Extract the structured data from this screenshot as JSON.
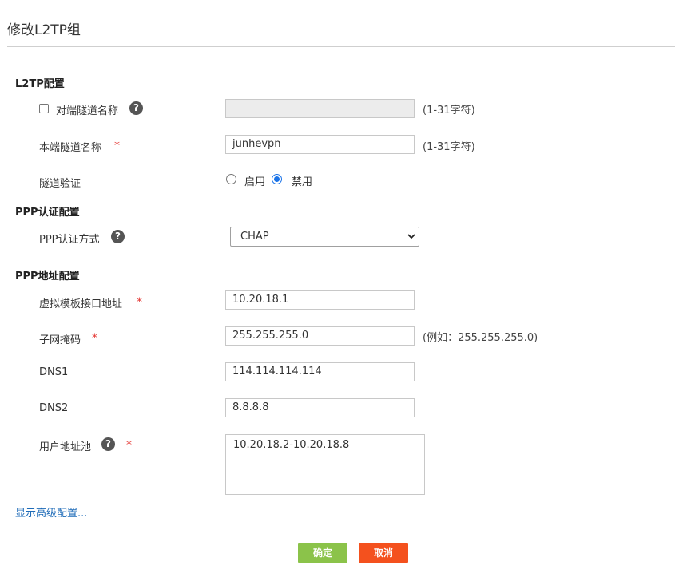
{
  "page": {
    "title": "修改L2TP组"
  },
  "sections": {
    "l2tp": "L2TP配置",
    "ppp_auth": "PPP认证配置",
    "ppp_addr": "PPP地址配置"
  },
  "fields": {
    "peer_tunnel": {
      "label": "对端隧道名称",
      "value": "",
      "hint": "(1-31字符)",
      "checked": false
    },
    "local_tunnel": {
      "label": "本端隧道名称",
      "value": "junhevpn",
      "hint": "(1-31字符)"
    },
    "tunnel_auth": {
      "label": "隧道验证",
      "option_enable": "启用",
      "option_disable": "禁用",
      "selected": "禁用"
    },
    "ppp_auth_mode": {
      "label": "PPP认证方式",
      "value": "CHAP"
    },
    "virtual_template": {
      "label": "虚拟模板接口地址",
      "value": "10.20.18.1"
    },
    "subnet_mask": {
      "label": "子网掩码",
      "value": "255.255.255.0",
      "hint": "(例如：255.255.255.0)"
    },
    "dns1": {
      "label": "DNS1",
      "value": "114.114.114.114"
    },
    "dns2": {
      "label": "DNS2",
      "value": "8.8.8.8"
    },
    "user_pool": {
      "label": "用户地址池",
      "value": "10.20.18.2-10.20.18.8"
    }
  },
  "required_mark": "*",
  "help_glyph": "?",
  "advanced_link": "显示高级配置...",
  "buttons": {
    "ok": "确定",
    "cancel": "取消"
  },
  "colors": {
    "ok": "#8bc34a",
    "cancel": "#f4511e",
    "link": "#1e6bb8",
    "required": "#e53935"
  }
}
